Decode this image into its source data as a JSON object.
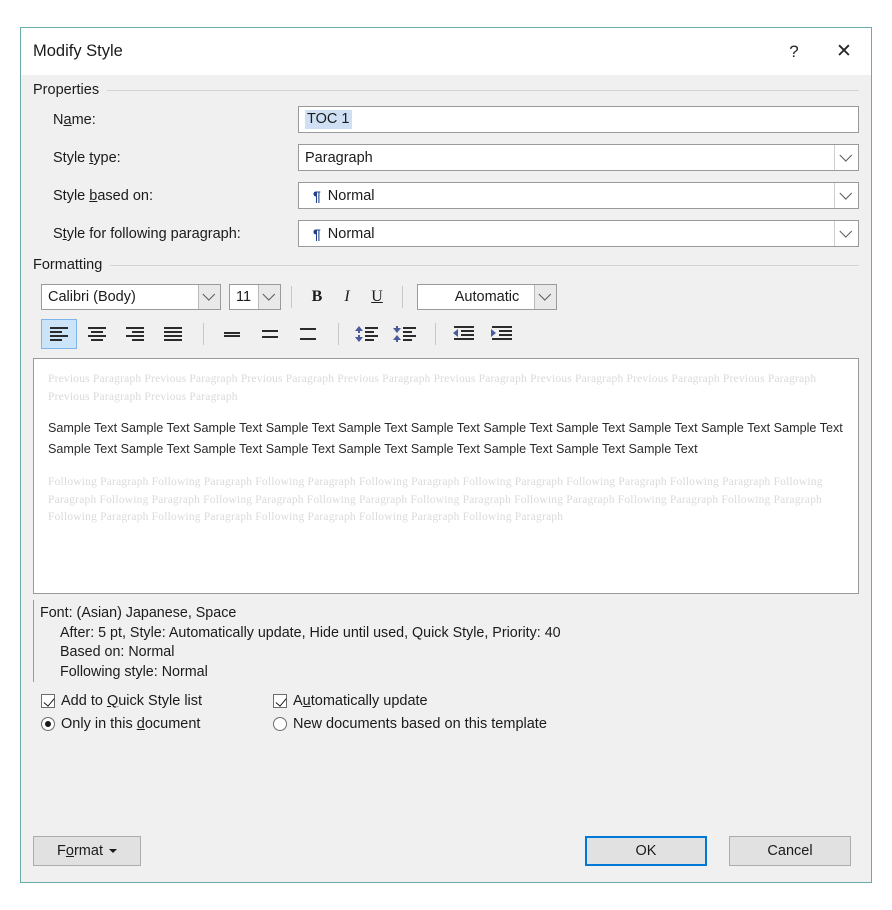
{
  "dialog": {
    "title": "Modify Style",
    "help_icon": "?",
    "close_icon": "✕",
    "accent_color": "#6aada8"
  },
  "properties": {
    "group_label": "Properties",
    "name": {
      "label_pre": "N",
      "label_key": "a",
      "label_post": "me:",
      "value": "TOC 1"
    },
    "style_type": {
      "label_pre": "Style ",
      "label_key": "t",
      "label_post": "ype:",
      "value": "Paragraph"
    },
    "style_based_on": {
      "label_pre": "Style ",
      "label_key": "b",
      "label_post": "ased on:",
      "value": "Normal",
      "glyph": "¶"
    },
    "style_following": {
      "label_pre": "S",
      "label_key": "t",
      "label_post": "yle for following paragraph:",
      "value": "Normal",
      "glyph": "¶"
    }
  },
  "formatting": {
    "group_label": "Formatting",
    "font_family": "Calibri (Body)",
    "font_size": "11",
    "bold_label": "B",
    "italic_label": "I",
    "underline_label": "U",
    "font_color": "Automatic",
    "alignment_active": "align-left",
    "buttons": [
      "align-left",
      "align-center",
      "align-right",
      "align-justify",
      "line-spacing-single",
      "line-spacing-1.5",
      "line-spacing-double",
      "decrease-space-before",
      "increase-space-after",
      "decrease-indent",
      "increase-indent"
    ]
  },
  "preview": {
    "previous_paragraph": "Previous Paragraph Previous Paragraph Previous Paragraph Previous Paragraph Previous Paragraph Previous Paragraph Previous Paragraph Previous Paragraph Previous Paragraph Previous Paragraph",
    "sample_text": "Sample Text Sample Text Sample Text Sample Text Sample Text Sample Text Sample Text Sample Text Sample Text Sample Text Sample Text Sample Text Sample Text Sample Text Sample Text Sample Text Sample Text Sample Text Sample Text Sample Text",
    "following_paragraph": "Following Paragraph Following Paragraph Following Paragraph Following Paragraph Following Paragraph Following Paragraph Following Paragraph Following Paragraph Following Paragraph Following Paragraph Following Paragraph Following Paragraph Following Paragraph Following Paragraph Following Paragraph Following Paragraph Following Paragraph Following Paragraph Following Paragraph Following Paragraph"
  },
  "description": {
    "line1": "Font: (Asian) Japanese, Space",
    "line2": "After:  5 pt, Style: Automatically update, Hide until used, Quick Style, Priority: 40",
    "line3": "Based on: Normal",
    "line4": "Following style: Normal"
  },
  "options": {
    "add_to_quick_style": {
      "label_pre": "Add to ",
      "label_key": "Q",
      "label_post": "uick Style list",
      "checked": true
    },
    "automatically_update": {
      "label_pre": "A",
      "label_key": "u",
      "label_post": "tomatically update",
      "checked": true
    },
    "only_this_document": {
      "label_pre": "Only in this ",
      "label_key": "d",
      "label_post": "ocument",
      "selected": true
    },
    "new_documents": {
      "label_pre": "New documents based on this template",
      "label_key": "",
      "label_post": "",
      "selected": false
    }
  },
  "footer": {
    "format_pre": "F",
    "format_key": "o",
    "format_post": "rmat",
    "ok": "OK",
    "cancel": "Cancel"
  }
}
